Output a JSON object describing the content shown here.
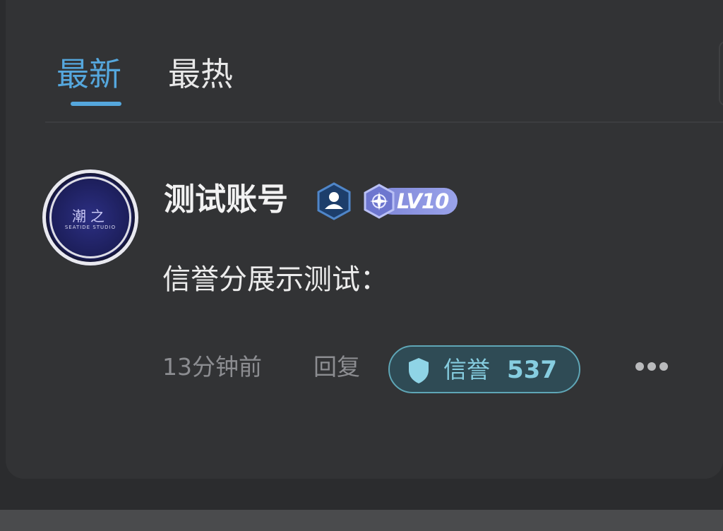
{
  "tabs": [
    {
      "label": "最新",
      "active": true
    },
    {
      "label": "最热",
      "active": false
    }
  ],
  "post": {
    "avatar": {
      "logo_text": "潮之",
      "subtitle": "SEATIDE STUDIO"
    },
    "username": "测试账号",
    "level": "LV10",
    "content": "信誉分展示测试：",
    "time": "13分钟前",
    "reply_label": "回复",
    "credit": {
      "label": "信誉",
      "value": "537"
    }
  },
  "colors": {
    "accent": "#55a7dd",
    "credit_text": "#86cde0",
    "level_badge": "#8f97e2"
  },
  "icons": {
    "cert": "verified-user-icon",
    "level": "compass-star-icon",
    "credit": "shield-icon",
    "more": "more-horizontal-icon"
  }
}
